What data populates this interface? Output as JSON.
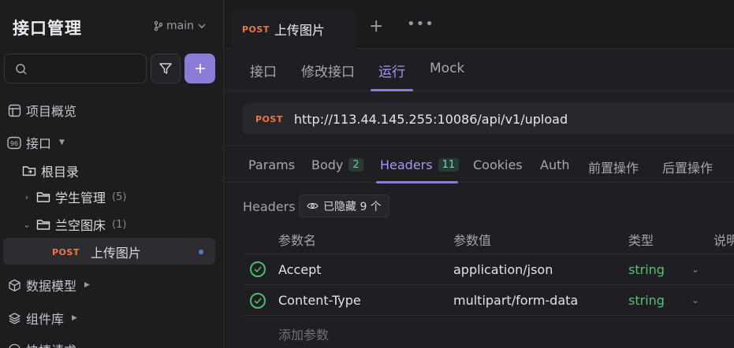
{
  "sidebar": {
    "title": "接口管理",
    "branch": "main",
    "nav": {
      "overview": "项目概览",
      "apis": "接口",
      "data_models": "数据模型",
      "components": "组件库",
      "quick_request": "快捷请求"
    },
    "tree": {
      "root": "根目录",
      "folder1": {
        "label": "学生管理",
        "count": "(5)"
      },
      "folder2": {
        "label": "兰空图床",
        "count": "(1)"
      },
      "endpoint": {
        "method": "POST",
        "label": "上传图片"
      }
    }
  },
  "tabbar": {
    "active_tab": {
      "method": "POST",
      "label": "上传图片"
    }
  },
  "subtabs": [
    "接口",
    "修改接口",
    "运行",
    "Mock"
  ],
  "request": {
    "method": "POST",
    "url": "http://113.44.145.255:10086/api/v1/upload"
  },
  "req_tabs": {
    "params": "Params",
    "body": "Body",
    "body_count": "2",
    "headers": "Headers",
    "headers_count": "11",
    "cookies": "Cookies",
    "auth": "Auth",
    "pre": "前置操作",
    "post": "后置操作"
  },
  "headers_panel": {
    "label": "Headers",
    "hidden_chip": "已隐藏 9 个",
    "columns": [
      "参数名",
      "参数值",
      "类型",
      "说明"
    ],
    "rows": [
      {
        "name": "Accept",
        "value": "application/json",
        "type": "string"
      },
      {
        "name": "Content-Type",
        "value": "multipart/form-data",
        "type": "string"
      }
    ],
    "add_param": "添加参数"
  },
  "colors": {
    "accent": "#8d7bd8",
    "post": "#f4753f",
    "type_green": "#56c271"
  }
}
